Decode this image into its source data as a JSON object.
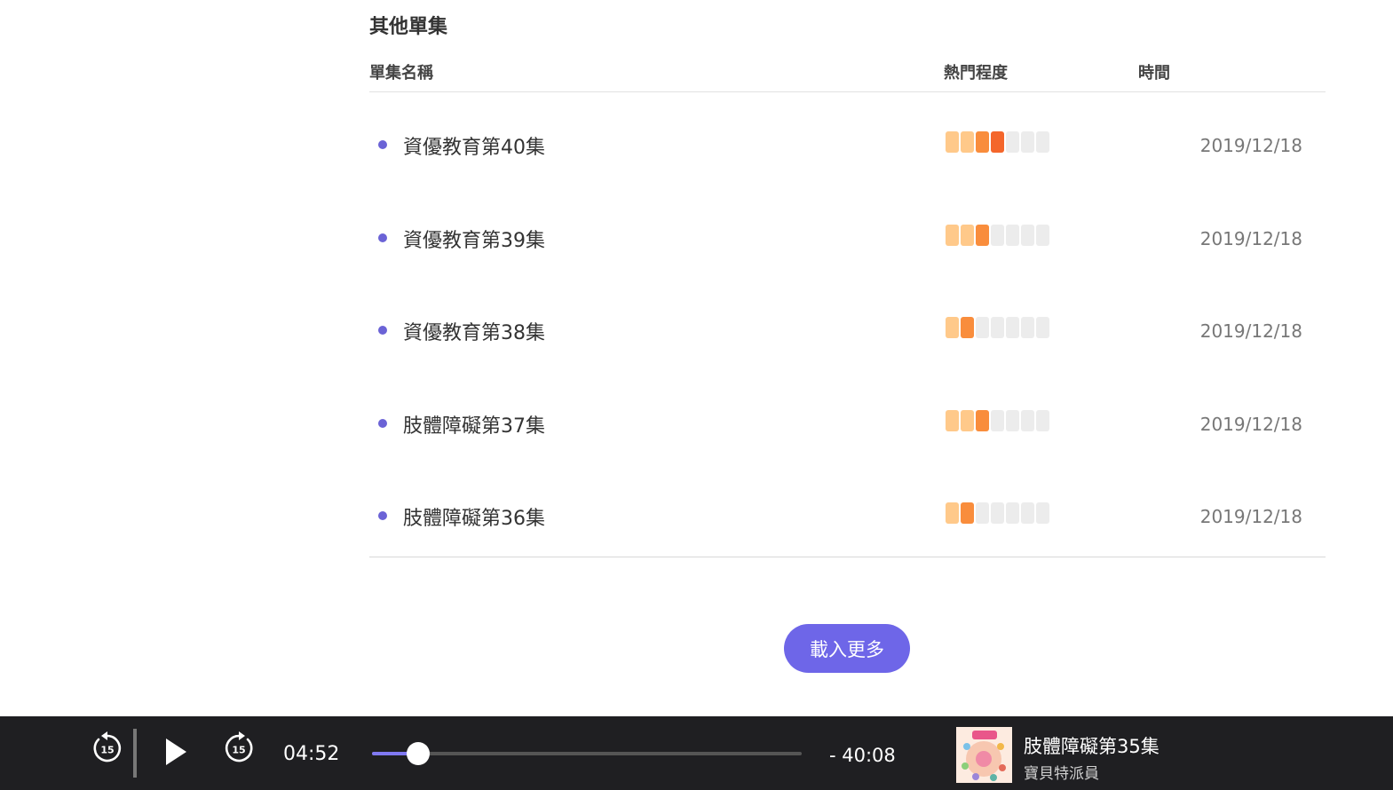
{
  "section": {
    "title": "其他單集",
    "columns": {
      "name": "單集名稱",
      "popularity": "熱門程度",
      "time": "時間"
    }
  },
  "episodes": [
    {
      "title": "資優教育第40集",
      "popularity": 4,
      "date": "2019/12/18"
    },
    {
      "title": "資優教育第39集",
      "popularity": 3,
      "date": "2019/12/18"
    },
    {
      "title": "資優教育第38集",
      "popularity": 2,
      "date": "2019/12/18"
    },
    {
      "title": "肢體障礙第37集",
      "popularity": 3,
      "date": "2019/12/18"
    },
    {
      "title": "肢體障礙第36集",
      "popularity": 2,
      "date": "2019/12/18"
    }
  ],
  "popularity_max": 7,
  "load_more_label": "載入更多",
  "player": {
    "skip_back_seconds": "15",
    "skip_forward_seconds": "15",
    "current_time": "04:52",
    "remaining_time": "-  40:08",
    "progress": 0.108,
    "now_playing_title": "肢體障礙第35集",
    "now_playing_channel": "寶貝特派員",
    "cover_icon": "podcast-cover-art"
  },
  "colors": {
    "accent": "#6e66e8",
    "bullet": "#6b63d6",
    "bar_empty": "#ececec",
    "bar_levels": [
      "#ffc98a",
      "#ffac57",
      "#f98d3c",
      "#f4662b"
    ],
    "player_bg": "#1f1f22"
  }
}
